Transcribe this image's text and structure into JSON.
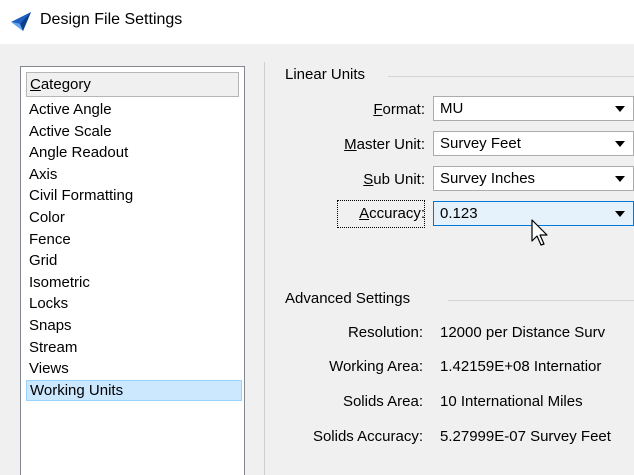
{
  "window": {
    "title": "Design File Settings"
  },
  "category": {
    "header": "Category",
    "header_key": "C",
    "header_rest": "ategory",
    "items": [
      "Active Angle",
      "Active Scale",
      "Angle Readout",
      "Axis",
      "Civil Formatting",
      "Color",
      "Fence",
      "Grid",
      "Isometric",
      "Locks",
      "Snaps",
      "Stream",
      "Views",
      "Working Units"
    ],
    "selected": "Working Units"
  },
  "linear_units": {
    "title": "Linear Units",
    "format": {
      "key": "F",
      "rest": "ormat:",
      "value": "MU"
    },
    "master_unit": {
      "key": "M",
      "rest": "aster Unit:",
      "value": "Survey Feet"
    },
    "sub_unit": {
      "key": "S",
      "rest": "ub Unit:",
      "value": "Survey Inches"
    },
    "accuracy": {
      "key": "A",
      "rest": "ccuracy:",
      "value": "0.123"
    }
  },
  "advanced": {
    "title": "Advanced Settings",
    "rows": [
      {
        "label": "Resolution:",
        "value": "12000 per Distance Surv"
      },
      {
        "label": "Working Area:",
        "value": "1.42159E+08 Internatior"
      },
      {
        "label": "Solids Area:",
        "value": "10 International Miles"
      },
      {
        "label": "Solids Accuracy:",
        "value": "5.27999E-07 Survey Feet"
      }
    ]
  },
  "colors": {
    "selection": "#cce8ff",
    "focus": "#0078d7",
    "panel": "#f0f0f0"
  },
  "icons": {
    "app": "microstation-icon",
    "pointer": "mouse-pointer-icon"
  }
}
